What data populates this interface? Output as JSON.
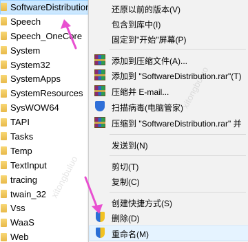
{
  "tree": {
    "items": [
      {
        "label": "SoftwareDistribution",
        "selected": true
      },
      {
        "label": "Speech",
        "selected": false
      },
      {
        "label": "Speech_OneCore",
        "selected": false
      },
      {
        "label": "System",
        "selected": false
      },
      {
        "label": "System32",
        "selected": false
      },
      {
        "label": "SystemApps",
        "selected": false
      },
      {
        "label": "SystemResources",
        "selected": false
      },
      {
        "label": "SysWOW64",
        "selected": false
      },
      {
        "label": "TAPI",
        "selected": false
      },
      {
        "label": "Tasks",
        "selected": false
      },
      {
        "label": "Temp",
        "selected": false
      },
      {
        "label": "TextInput",
        "selected": false
      },
      {
        "label": "tracing",
        "selected": false
      },
      {
        "label": "twain_32",
        "selected": false
      },
      {
        "label": "Vss",
        "selected": false
      },
      {
        "label": "WaaS",
        "selected": false
      },
      {
        "label": "Web",
        "selected": false
      }
    ]
  },
  "menu": {
    "restore": "还原以前的版本(V)",
    "include_lib": "包含到库中(I)",
    "pin_start": "固定到\"开始\"屏幕(P)",
    "add_archive": "添加到压缩文件(A)...",
    "add_rar": "添加到 \"SoftwareDistribution.rar\"(T)",
    "compress_email": "压缩并 E-mail...",
    "scan_virus": "扫描病毒(电脑管家)",
    "compress_rar_email": "压缩到 \"SoftwareDistribution.rar\" 并",
    "send_to": "发送到(N)",
    "cut": "剪切(T)",
    "copy": "复制(C)",
    "create_shortcut": "创建快捷方式(S)",
    "delete": "删除(D)",
    "rename": "重命名(M)"
  },
  "icons": {
    "folder": "folder-icon",
    "archive": "winrar-icon",
    "scan": "shield-scan-icon",
    "uac": "uac-shield-icon"
  },
  "colors": {
    "selection": "#cce8ff",
    "menu_bg": "#f2f2f2",
    "arrow": "#e84fd0"
  }
}
